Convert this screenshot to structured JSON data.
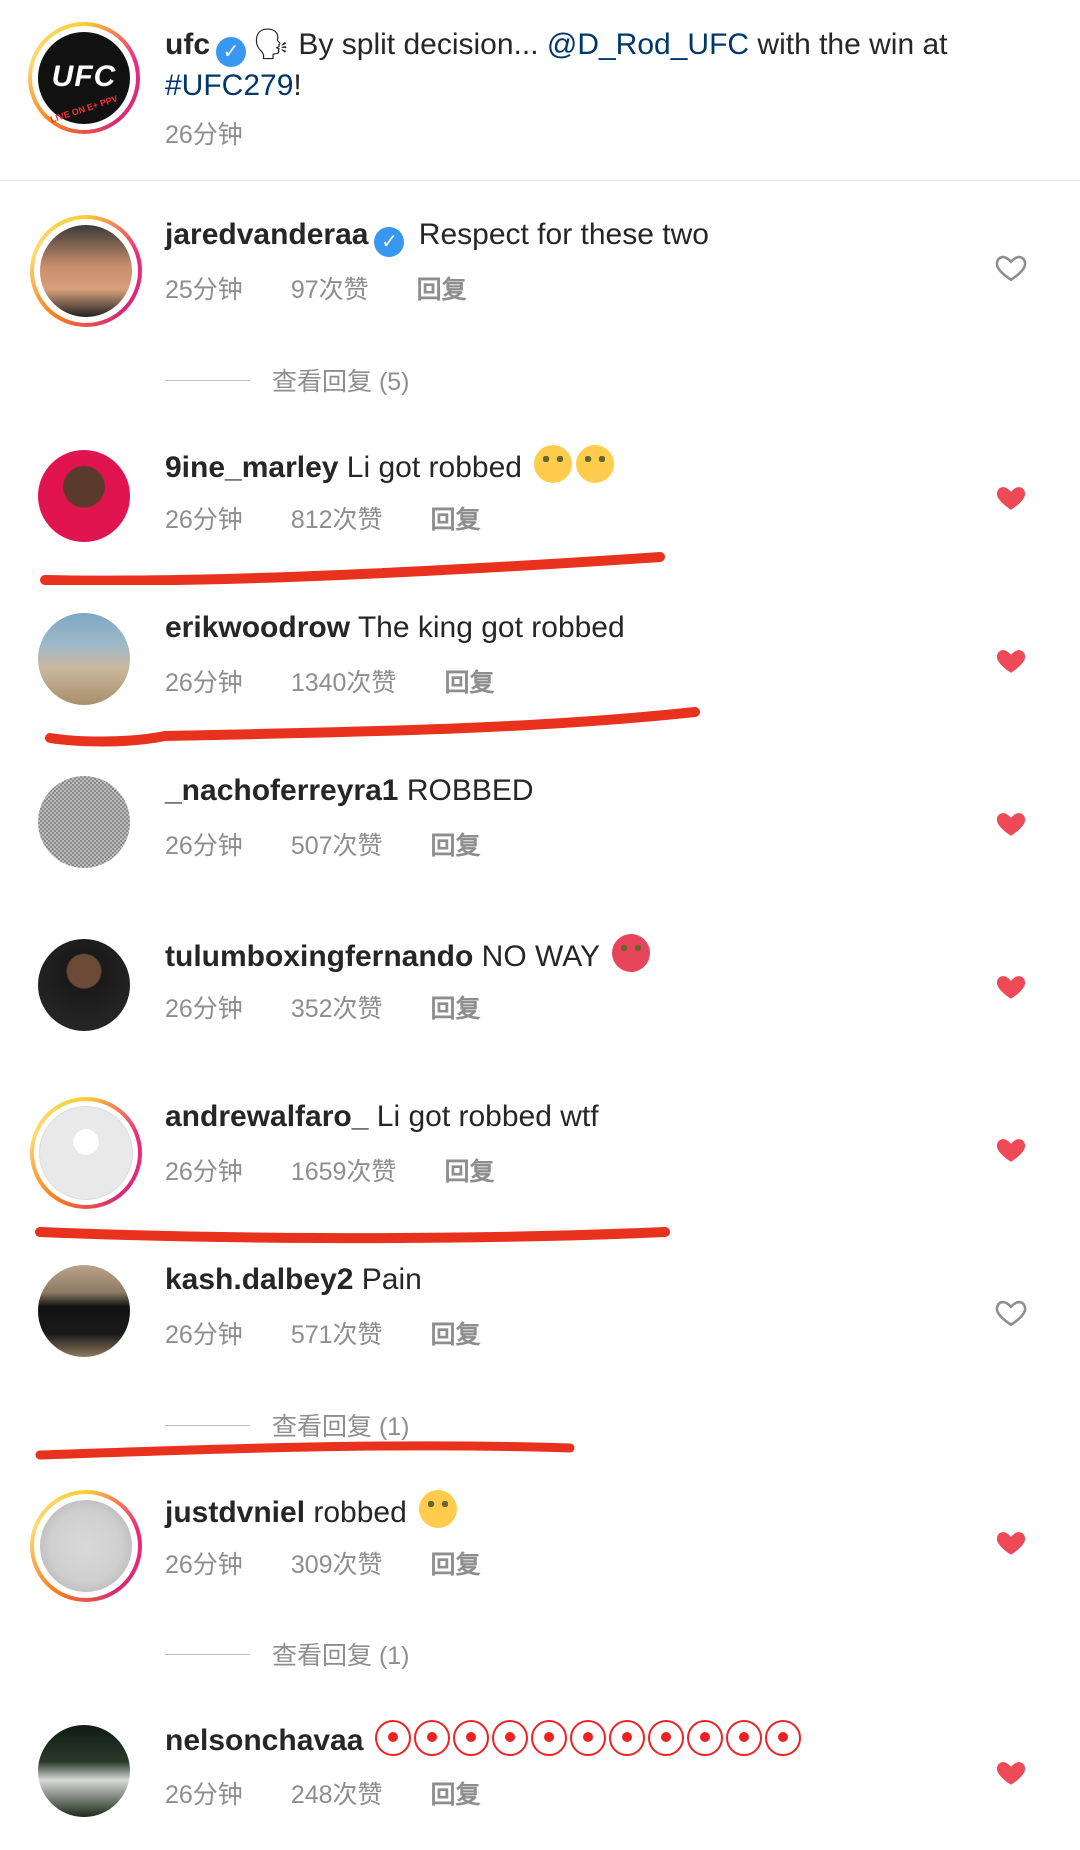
{
  "post": {
    "username": "ufc",
    "caption_emoji": "🗣",
    "caption_text": " By split decision... ",
    "mention": "@D_Rod_UFC",
    "caption_mid": " with the win at",
    "hashtag": "#UFC279",
    "caption_end": "!",
    "time": "26分钟",
    "logo_text": "UFC",
    "logo_sub": "LIVE ON E+ PPV"
  },
  "comments": [
    {
      "username": "jaredvanderaa",
      "verified": "✓",
      "text": "Respect for these two",
      "time": "25分钟",
      "likes": "97次赞",
      "reply": "回复",
      "liked": false
    },
    {
      "username": "9ine_marley",
      "text": "Li got robbed",
      "time": "26分钟",
      "likes": "812次赞",
      "reply": "回复",
      "liked": true
    },
    {
      "username": "erikwoodrow",
      "text": "The king got robbed",
      "time": "26分钟",
      "likes": "1340次赞",
      "reply": "回复",
      "liked": true
    },
    {
      "username": "_nachoferreyra1",
      "text": "ROBBED",
      "time": "26分钟",
      "likes": "507次赞",
      "reply": "回复",
      "liked": true
    },
    {
      "username": "tulumboxingfernando",
      "text": "NO WAY",
      "time": "26分钟",
      "likes": "352次赞",
      "reply": "回复",
      "liked": true
    },
    {
      "username": "andrewalfaro_",
      "text": "Li got robbed wtf",
      "time": "26分钟",
      "likes": "1659次赞",
      "reply": "回复",
      "liked": true
    },
    {
      "username": "kash.dalbey2",
      "text": "Pain",
      "time": "26分钟",
      "likes": "571次赞",
      "reply": "回复",
      "liked": false
    },
    {
      "username": "justdvniel",
      "text": "robbed",
      "time": "26分钟",
      "likes": "309次赞",
      "reply": "回复",
      "liked": true
    },
    {
      "username": "nelsonchavaa",
      "text": "",
      "time": "26分钟",
      "likes": "248次赞",
      "reply": "回复",
      "liked": true
    }
  ],
  "view_replies": [
    "查看回复 (5)",
    "查看回复 (1)",
    "查看回复 (1)"
  ],
  "colors": {
    "heart_red": "#ed4956",
    "annotation_red": "#e8321e",
    "link_blue": "#00376b",
    "meta_gray": "#8e8e8e"
  }
}
